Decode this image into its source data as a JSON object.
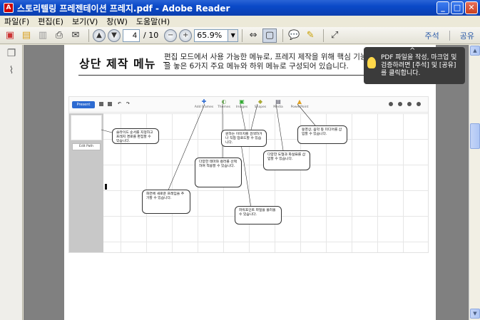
{
  "window": {
    "title": "스토리텔링 프레젠테이션 프레지.pdf - Adobe Reader",
    "icon": "adobe-reader-icon",
    "controls": {
      "minimize": "_",
      "maximize": "□",
      "close": "✕"
    }
  },
  "menu": [
    "파일(F)",
    "편집(E)",
    "보기(V)",
    "창(W)",
    "도움말(H)"
  ],
  "toolbar": {
    "page_current": "4",
    "page_total": "/ 10",
    "zoom": "65.9%",
    "comment": "주석",
    "share": "공유"
  },
  "tooltip": {
    "text": "PDF 파일을 작성, 마크업 및 검증하려면 [주석] 및 [공유]를 클릭합니다.",
    "caret": "^"
  },
  "document": {
    "heading": "상단 제작 메뉴",
    "description": "편집 모드에서 사용 가능한 메뉴로, 프레지 제작을 위해 핵심 기능들을 놓은 6가지 주요 메뉴와 하위 메뉴로 구성되어 있습니다.",
    "screenshot": {
      "present": "Present",
      "menus": [
        {
          "label": "Add Frames",
          "glyph": "✚",
          "color": "#2d6bd1"
        },
        {
          "label": "Themes",
          "glyph": "◐",
          "color": "#7a6"
        },
        {
          "label": "Images",
          "glyph": "▣",
          "color": "#3a3"
        },
        {
          "label": "Shapes",
          "glyph": "◆",
          "color": "#aa3"
        },
        {
          "label": "Media",
          "glyph": "▤",
          "color": "#445"
        },
        {
          "label": "PowerPoint",
          "glyph": "▲",
          "color": "#e0a020"
        }
      ],
      "edit_path": "Edit Path",
      "callouts": [
        "슬라이드 순서를 지정하고 프레지 경로를 편집할 수 있습니다.",
        "화면에 새로운 프레임을 추가할 수 있습니다.",
        "다양한 테마와 컬러를 선택하여 적용할 수 있습니다.",
        "원하는 이미지를 검색하거나 직접 업로드할 수 있습니다.",
        "다양한 도형과 화살표를 삽입할 수 있습니다.",
        "동영상, 음악 등 미디어를 삽입할 수 있습니다.",
        "파워포인트 파일을 불러올 수 있습니다.",
        "프레지의 모든 기능을 이용할 수 있습니다."
      ]
    }
  },
  "colors": {
    "titlebar": "#0a49c8",
    "accent_link": "#2a5aa8",
    "present_button": "#2d6bd1",
    "tooltip_bg": "#3b3b3b",
    "doc_bg": "#808080"
  }
}
